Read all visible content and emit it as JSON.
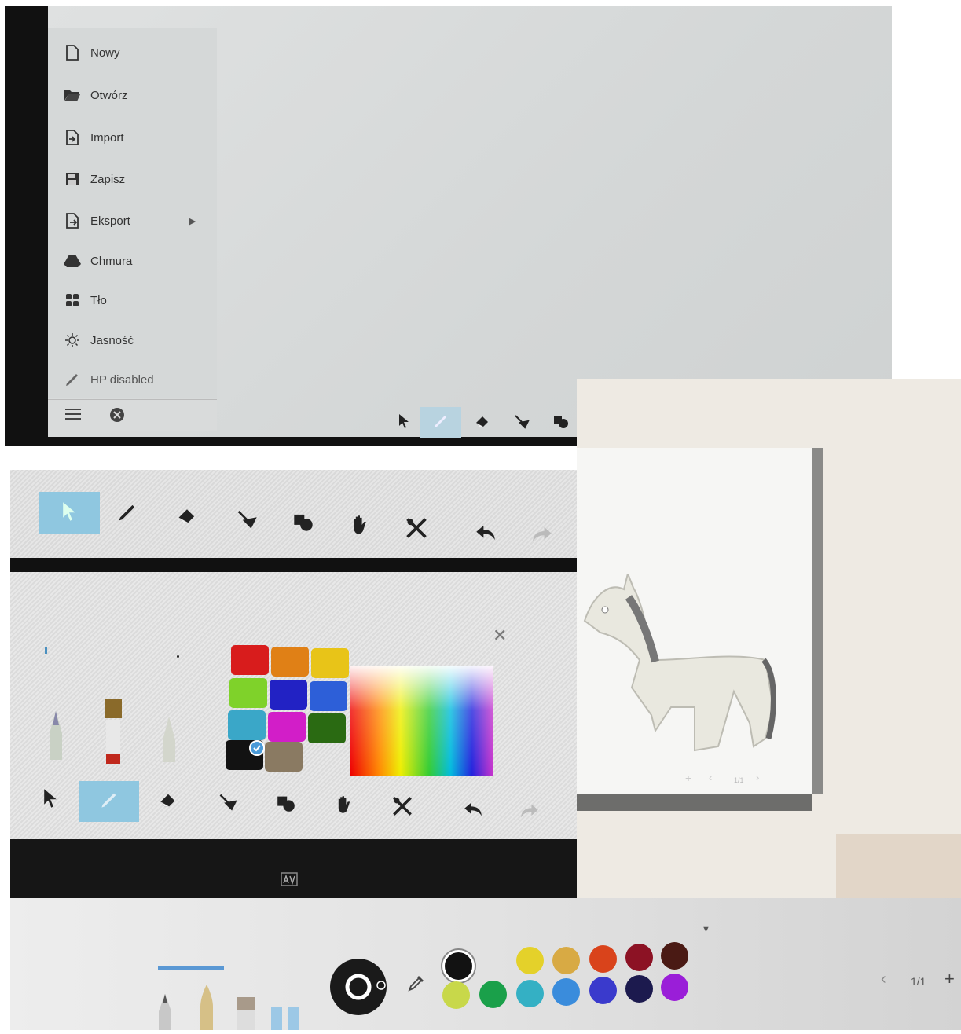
{
  "menu": {
    "items": [
      {
        "label": "Nowy",
        "icon": "new-file-icon"
      },
      {
        "label": "Otwórz",
        "icon": "folder-open-icon"
      },
      {
        "label": "Import",
        "icon": "import-icon"
      },
      {
        "label": "Zapisz",
        "icon": "save-icon"
      },
      {
        "label": "Eksport",
        "icon": "export-icon"
      },
      {
        "label": "Chmura",
        "icon": "cloud-drive-icon"
      },
      {
        "label": "Tło",
        "icon": "background-icon"
      },
      {
        "label": "Jasność",
        "icon": "brightness-icon"
      },
      {
        "label": "HP disabled",
        "icon": "pen-icon"
      }
    ]
  },
  "toolbar": {
    "tools": [
      "select-icon",
      "pen-icon",
      "eraser-icon",
      "lasso-icon",
      "shapes-icon",
      "hand-icon",
      "tools-icon",
      "undo-icon",
      "redo-icon"
    ]
  },
  "color_picker": {
    "swatches": [
      "#d81c1c",
      "#e08016",
      "#e8c418",
      "#7fd22a",
      "#2222c4",
      "#2d5fd8",
      "#3aa7c8",
      "#d21ec8",
      "#2a6a12",
      "#121212",
      "#8a7a62"
    ],
    "selected": "#121212"
  },
  "pen_panel": {
    "colors_top": [
      "#121212",
      "#e4d12a",
      "#d8aa44",
      "#d9431b",
      "#8c1224",
      "#4a1a14"
    ],
    "colors_bottom": [
      "#c8d84a",
      "#1aa04a",
      "#34b0c4",
      "#3a8cdc",
      "#3a3acc",
      "#1c1a4e",
      "#9a1ed8"
    ],
    "page_indicator": "1/1"
  },
  "drawing": {
    "page_indicator": "1/1"
  }
}
